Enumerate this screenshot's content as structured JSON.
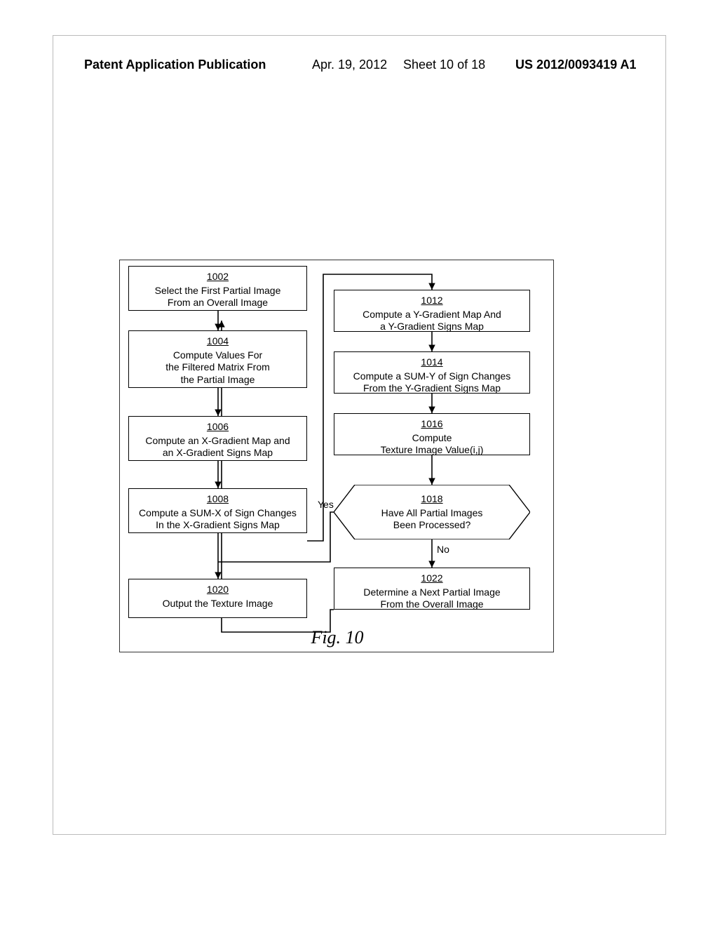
{
  "header": {
    "pubtype": "Patent Application Publication",
    "date": "Apr. 19, 2012",
    "sheet": "Sheet 10 of 18",
    "pubno": "US 2012/0093419 A1"
  },
  "fig_caption": "Fig. 10",
  "decision_labels": {
    "yes": "Yes",
    "no": "No"
  },
  "boxes": {
    "b1002": {
      "ref": "1002",
      "text": "Select the First Partial Image\nFrom an Overall Image"
    },
    "b1004": {
      "ref": "1004",
      "text": "Compute Values For\nthe Filtered Matrix From\nthe Partial Image"
    },
    "b1006": {
      "ref": "1006",
      "text": "Compute an X-Gradient Map and\nan X-Gradient Signs Map"
    },
    "b1008": {
      "ref": "1008",
      "text": "Compute a SUM-X of Sign Changes\nIn the X-Gradient Signs Map"
    },
    "b1020": {
      "ref": "1020",
      "text": "Output the Texture Image"
    },
    "b1012": {
      "ref": "1012",
      "text": "Compute a Y-Gradient Map And\na Y-Gradient Signs Map"
    },
    "b1014": {
      "ref": "1014",
      "text": "Compute a SUM-Y of Sign Changes\nFrom the Y-Gradient Signs Map"
    },
    "b1016": {
      "ref": "1016",
      "text": "Compute\nTexture Image Value(i,j)"
    },
    "b1018": {
      "ref": "1018",
      "text": "Have All Partial Images\nBeen Processed?"
    },
    "b1022": {
      "ref": "1022",
      "text": "Determine a Next Partial Image\nFrom the Overall Image"
    }
  }
}
